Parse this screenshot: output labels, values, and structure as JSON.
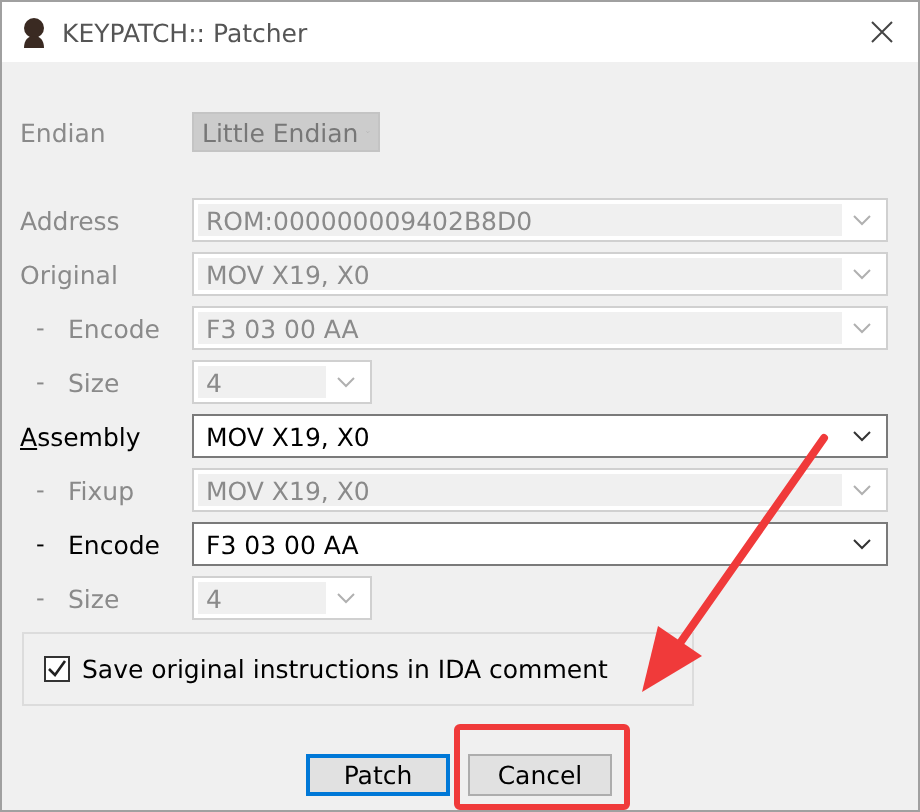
{
  "window": {
    "title": "KEYPATCH:: Patcher"
  },
  "endian": {
    "label": "Endian",
    "value": "Little Endian",
    "disabled": true
  },
  "fields": [
    {
      "label": "Address",
      "value": "ROM:000000009402B8D0",
      "disabled": true,
      "kind": "wide"
    },
    {
      "label": "Original",
      "value": "MOV X19, X0",
      "disabled": true,
      "kind": "wide",
      "children": [
        {
          "bullet": "-",
          "label": "Encode",
          "value": "F3 03 00 AA",
          "disabled": true,
          "kind": "wide"
        },
        {
          "bullet": "-",
          "label": "Size",
          "value": "4",
          "disabled": true,
          "kind": "narrow"
        }
      ]
    },
    {
      "mnemonic": "A",
      "label": "ssembly",
      "value": "MOV X19, X0",
      "disabled": false,
      "kind": "wide",
      "children": [
        {
          "bullet": "-",
          "label": "Fixup",
          "value": "MOV X19, X0",
          "disabled": true,
          "kind": "wide"
        },
        {
          "bullet": "-",
          "label": "Encode",
          "value": "F3 03 00 AA",
          "disabled": false,
          "kind": "wide"
        },
        {
          "bullet": "-",
          "label": "Size",
          "value": "4",
          "disabled": true,
          "kind": "narrow"
        }
      ]
    }
  ],
  "option": {
    "label": "Save original instructions in IDA comment",
    "checked": true
  },
  "buttons": [
    {
      "label": "Patch",
      "default": true
    },
    {
      "label": "Cancel",
      "default": false
    }
  ]
}
